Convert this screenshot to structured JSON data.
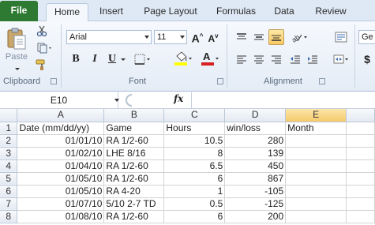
{
  "tabs": [
    {
      "label": "File"
    },
    {
      "label": "Home"
    },
    {
      "label": "Insert"
    },
    {
      "label": "Page Layout"
    },
    {
      "label": "Formulas"
    },
    {
      "label": "Data"
    },
    {
      "label": "Review"
    }
  ],
  "colors": {
    "file_tab": "#2f7a33",
    "ribbon": "#e4ecf6",
    "selected_header": "#f5c96c",
    "font_color_bar": "#d82020",
    "fill_color_bar": "#ffff00"
  },
  "clipboard": {
    "paste_label": "Paste",
    "group_label": "Clipboard"
  },
  "font": {
    "name": "Arial",
    "size": "11",
    "bold": "B",
    "italic": "I",
    "underline": "U",
    "group_label": "Font"
  },
  "alignment": {
    "group_label": "Alignment",
    "partial_label": "Ge"
  },
  "formula_bar": {
    "cell_ref": "E10",
    "fx": "fx",
    "value": ""
  },
  "sheet": {
    "columns": [
      "A",
      "B",
      "C",
      "D",
      "E"
    ],
    "selected_column": "E",
    "rows": [
      {
        "num": "1",
        "a": "Date (mm/dd/yy)",
        "b": "Game",
        "c": "Hours",
        "d": "win/loss",
        "e": "Month"
      },
      {
        "num": "2",
        "a": "01/01/10",
        "b": "RA 1/2-60",
        "c": "10.5",
        "d": "280",
        "e": ""
      },
      {
        "num": "3",
        "a": "01/02/10",
        "b": "LHE 8/16",
        "c": "8",
        "d": "139",
        "e": ""
      },
      {
        "num": "4",
        "a": "01/04/10",
        "b": "RA 1/2-60",
        "c": "6.5",
        "d": "450",
        "e": ""
      },
      {
        "num": "5",
        "a": "01/05/10",
        "b": "RA 1/2-60",
        "c": "6",
        "d": "867",
        "e": ""
      },
      {
        "num": "6",
        "a": "01/05/10",
        "b": "RA 4-20",
        "c": "1",
        "d": "-105",
        "e": ""
      },
      {
        "num": "7",
        "a": "01/07/10",
        "b": "5/10 2-7 TD",
        "c": "0.5",
        "d": "-125",
        "e": ""
      },
      {
        "num": "8",
        "a": "01/08/10",
        "b": "RA 1/2-60",
        "c": "6",
        "d": "200",
        "e": ""
      }
    ]
  }
}
